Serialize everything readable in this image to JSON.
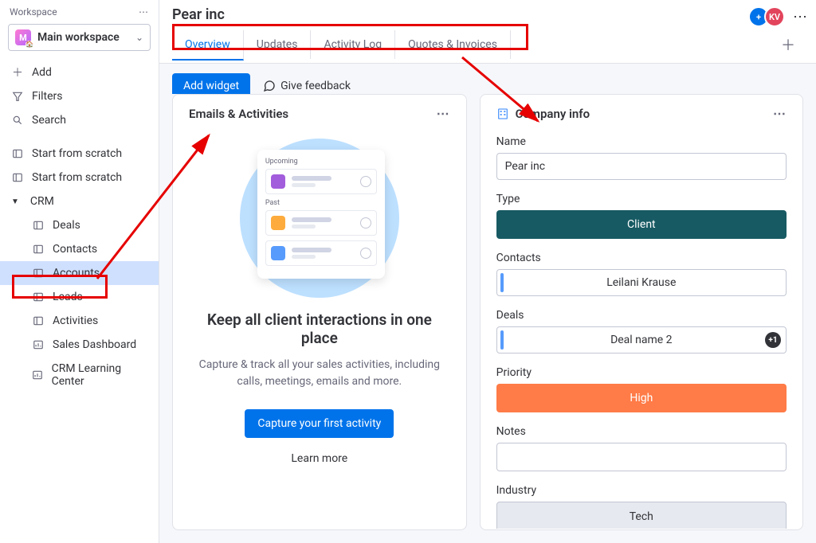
{
  "workspace": {
    "label": "Workspace",
    "selected": "Main workspace",
    "badge": "M"
  },
  "side_actions": {
    "add": "Add",
    "filters": "Filters",
    "search": "Search"
  },
  "side_boards": {
    "scratch1": "Start from scratch",
    "scratch2": "Start from scratch"
  },
  "crm": {
    "label": "CRM",
    "items": {
      "deals": "Deals",
      "contacts": "Contacts",
      "accounts": "Accounts",
      "leads": "Leads",
      "activities": "Activities",
      "dashboard": "Sales Dashboard",
      "learning": "CRM Learning Center"
    }
  },
  "header": {
    "title": "Pear inc",
    "avatar2": "KV"
  },
  "tabs": {
    "overview": "Overview",
    "updates": "Updates",
    "activity": "Activity Log",
    "quotes": "Quotes & Invoices"
  },
  "toolbar": {
    "add_widget": "Add widget",
    "feedback": "Give feedback"
  },
  "emails_card": {
    "title": "Emails & Activities",
    "illu_upcoming": "Upcoming",
    "illu_past": "Past",
    "heading": "Keep all client interactions in one place",
    "text": "Capture & track all your sales activities, including calls, meetings, emails and more.",
    "cta": "Capture your first activity",
    "learn": "Learn more"
  },
  "info_card": {
    "title": "Company info",
    "fields": {
      "name_label": "Name",
      "name_value": "Pear inc",
      "type_label": "Type",
      "type_value": "Client",
      "contacts_label": "Contacts",
      "contacts_value": "Leilani Krause",
      "deals_label": "Deals",
      "deals_value": "Deal name 2",
      "deals_extra": "+1",
      "priority_label": "Priority",
      "priority_value": "High",
      "notes_label": "Notes",
      "industry_label": "Industry",
      "industry_value": "Tech"
    }
  }
}
